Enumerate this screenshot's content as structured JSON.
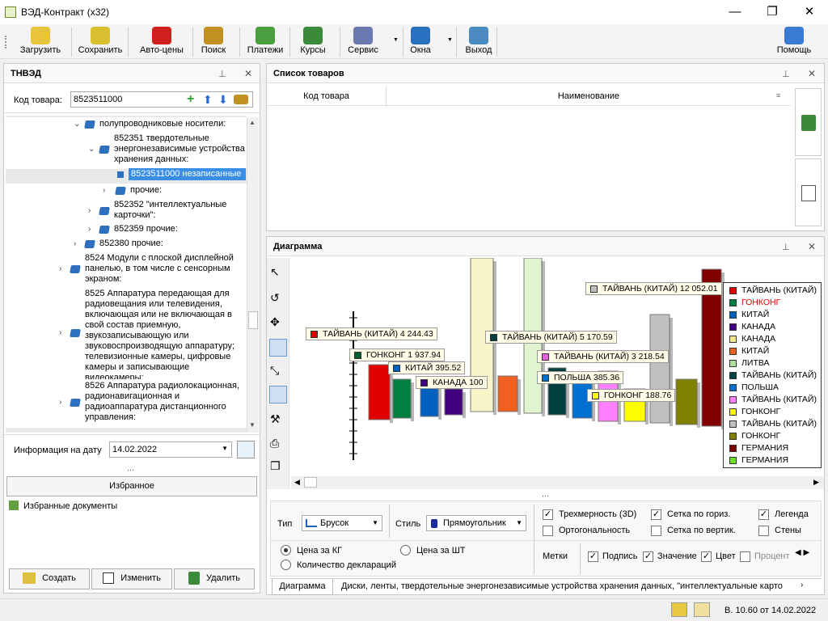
{
  "window": {
    "title": "ВЭД-Контракт (x32)",
    "min": "—",
    "max": "❐",
    "close": "✕"
  },
  "toolbar": [
    {
      "key": "load",
      "label": "Загрузить",
      "icon": "folder-open-icon",
      "color": "#e8c43a"
    },
    {
      "key": "save",
      "label": "Сохранить",
      "icon": "folder-save-icon",
      "color": "#d8c030"
    },
    {
      "key": "autoprice",
      "label": "Авто-цены",
      "icon": "car-icon",
      "color": "#d02020"
    },
    {
      "key": "search",
      "label": "Поиск",
      "icon": "binoculars-icon",
      "color": "#c09020"
    },
    {
      "key": "payments",
      "label": "Платежи",
      "icon": "money-icon",
      "color": "#4aa040"
    },
    {
      "key": "rates",
      "label": "Курсы",
      "icon": "coins-icon",
      "color": "#3a8a3a"
    },
    {
      "key": "service",
      "label": "Сервис",
      "icon": "tools-icon",
      "color": "#6a7ab0"
    },
    {
      "key": "windows",
      "label": "Окна",
      "icon": "windows-icon",
      "color": "#2a70c0"
    },
    {
      "key": "exit",
      "label": "Выход",
      "icon": "exit-icon",
      "color": "#4a8ac0"
    },
    {
      "key": "help",
      "label": "Помощь",
      "icon": "help-icon",
      "color": "#3a7ad0"
    }
  ],
  "tnved": {
    "title": "ТНВЭД",
    "code_label": "Код товара:",
    "code_value": "8523511000",
    "tree": [
      {
        "text": "полупроводниковые носители:",
        "exp": "⌄"
      },
      {
        "text": "852351 твердотельные энергонезависимые устройства хранения данных:",
        "exp": "⌄"
      },
      {
        "text": "8523511000 незаписанные",
        "exp": ""
      },
      {
        "text": "прочие:",
        "exp": "›"
      },
      {
        "text": "852352 \"интеллектуальные карточки\":",
        "exp": "›"
      },
      {
        "text": "852359 прочие:",
        "exp": "›"
      },
      {
        "text": "852380 прочие:",
        "exp": "›"
      },
      {
        "text": "8524 Модули с плоской дисплейной панелью, в том числе с сенсорным экраном:",
        "exp": "›"
      },
      {
        "text": "8525 Аппаратура передающая для радиовещания или телевидения, включающая или не включающая в свой состав приемную, звукозаписывающую или звуковоспроизводящую аппаратуру; телевизионные камеры, цифровые камеры и записывающие видеокамеры:",
        "exp": "›"
      },
      {
        "text": "8526 Аппаратура радиолокационная, радионавигационная и радиоаппаратура дистанционного управления:",
        "exp": "›"
      }
    ],
    "info_label": "Информация на дату",
    "info_date": "14.02.2022",
    "dots": "...",
    "fav_title": "Избранное",
    "fav_item": "Избранные документы",
    "btn_create": "Создать",
    "btn_edit": "Изменить",
    "btn_delete": "Удалить"
  },
  "goods": {
    "title": "Список товаров",
    "col_code": "Код товара",
    "col_name": "Наименование"
  },
  "diagram": {
    "title": "Диаграмма",
    "labels": [
      {
        "text": "ТАЙВАНЬ (КИТАЙ) 4 244.43",
        "color": "#e00000"
      },
      {
        "text": "ГОНКОНГ 1 937.94",
        "color": "#006030"
      },
      {
        "text": "КИТАЙ 395.52",
        "color": "#0060c0"
      },
      {
        "text": "КАНАДА 100",
        "color": "#400080"
      },
      {
        "text": "ТАЙВАНЬ (КИТАЙ) 5 170.59",
        "color": "#004040"
      },
      {
        "text": "ТАЙВАНЬ (КИТАЙ) 3 218.54",
        "color": "#e060e0"
      },
      {
        "text": "ПОЛЬША 385.36",
        "color": "#0070d0"
      },
      {
        "text": "ГОНКОНГ 188.76",
        "color": "#ffff00"
      },
      {
        "text": "ТАЙВАНЬ (КИТАЙ) 12 052.01",
        "color": "#c0c0c0"
      }
    ],
    "legend": [
      {
        "text": "ТАЙВАНЬ (КИТАЙ)",
        "color": "#e00000",
        "tc": "#000"
      },
      {
        "text": "ГОНКОНГ",
        "color": "#008040",
        "tc": "#e00000"
      },
      {
        "text": "КИТАЙ",
        "color": "#0060c0",
        "tc": "#000"
      },
      {
        "text": "КАНАДА",
        "color": "#400080",
        "tc": "#000"
      },
      {
        "text": "КАНАДА",
        "color": "#f0e890",
        "tc": "#000"
      },
      {
        "text": "КИТАЙ",
        "color": "#f06020",
        "tc": "#000"
      },
      {
        "text": "ЛИТВА",
        "color": "#b0e0a0",
        "tc": "#000"
      },
      {
        "text": "ТАЙВАНЬ (КИТАЙ)",
        "color": "#004040",
        "tc": "#000"
      },
      {
        "text": "ПОЛЬША",
        "color": "#0070d0",
        "tc": "#000"
      },
      {
        "text": "ТАЙВАНЬ (КИТАЙ)",
        "color": "#ff80ff",
        "tc": "#000"
      },
      {
        "text": "ГОНКОНГ",
        "color": "#ffff00",
        "tc": "#000"
      },
      {
        "text": "ТАЙВАНЬ (КИТАЙ)",
        "color": "#c0c0c0",
        "tc": "#000"
      },
      {
        "text": "ГОНКОНГ",
        "color": "#808000",
        "tc": "#000"
      },
      {
        "text": "ГЕРМАНИЯ",
        "color": "#800000",
        "tc": "#000"
      },
      {
        "text": "ГЕРМАНИЯ",
        "color": "#70e020",
        "tc": "#000"
      }
    ],
    "dots": "...",
    "type_label": "Тип",
    "type_value": "Брусок",
    "style_label": "Стиль",
    "style_value": "Прямоугольник",
    "opt_3d": "Трехмерность (3D)",
    "opt_ortho": "Ортогональность",
    "opt_hgrid": "Сетка по гориз.",
    "opt_vgrid": "Сетка по вертик.",
    "opt_legend": "Легенда",
    "opt_walls": "Стены",
    "price_kg": "Цена за КГ",
    "price_pc": "Цена за ШТ",
    "decl_count": "Количество деклараций",
    "marks_label": "Метки",
    "m_caption": "Подпись",
    "m_value": "Значение",
    "m_color": "Цвет",
    "m_percent": "Процент"
  },
  "tabs": {
    "tab1": "Диаграмма",
    "tab2": "Диски, ленты, твердотельные энергонезависимые устройства хранения данных, \"интеллектуальные карто"
  },
  "status": {
    "version": "В. 10.60 от 14.02.2022"
  }
}
